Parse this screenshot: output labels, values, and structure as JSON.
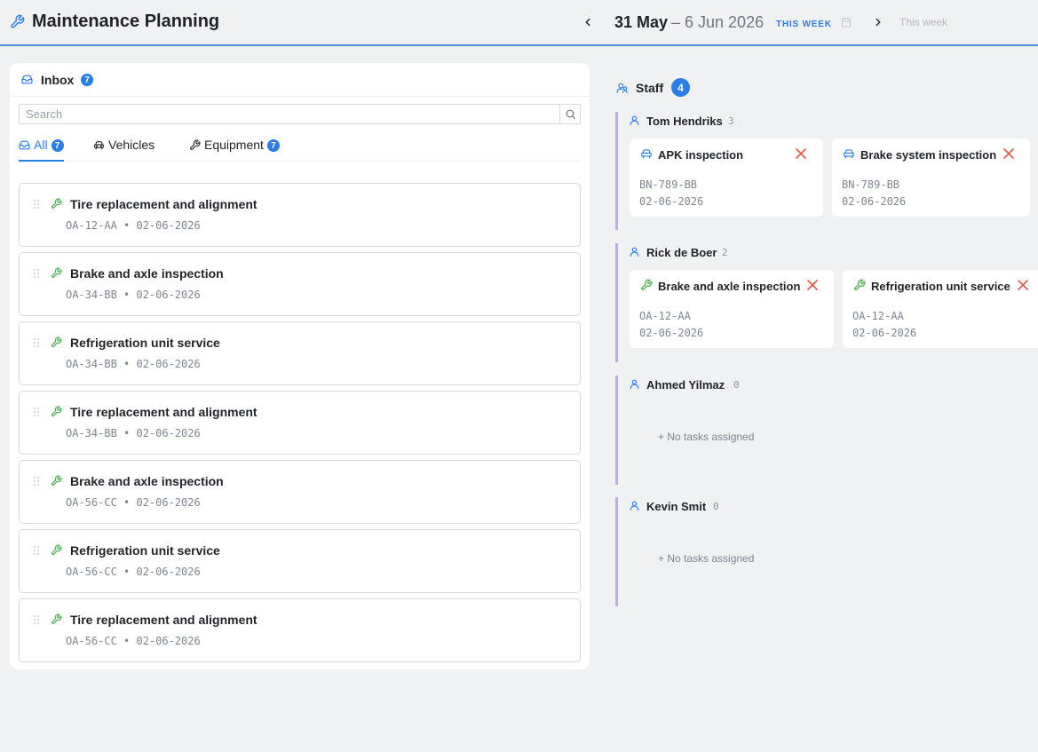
{
  "header": {
    "title": "Maintenance Planning",
    "range_start": "31 May",
    "range_end": "– 6 Jun 2026",
    "this_week_badge": "THIS WEEK",
    "week_label": "This week"
  },
  "inbox": {
    "title": "Inbox",
    "count": "7",
    "search_placeholder": "Search",
    "tabs": [
      {
        "label": "All",
        "count": "7",
        "active": true
      },
      {
        "label": "Vehicles",
        "count": "",
        "active": false
      },
      {
        "label": "Equipment",
        "count": "7",
        "active": false
      }
    ],
    "tasks": [
      {
        "title": "Tire replacement and alignment",
        "meta": "OA-12-AA • 02-06-2026"
      },
      {
        "title": "Brake and axle inspection",
        "meta": "OA-34-BB • 02-06-2026"
      },
      {
        "title": "Refrigeration unit service",
        "meta": "OA-34-BB • 02-06-2026"
      },
      {
        "title": "Tire replacement and alignment",
        "meta": "OA-34-BB • 02-06-2026"
      },
      {
        "title": "Brake and axle inspection",
        "meta": "OA-56-CC • 02-06-2026"
      },
      {
        "title": "Refrigeration unit service",
        "meta": "OA-56-CC • 02-06-2026"
      },
      {
        "title": "Tire replacement and alignment",
        "meta": "OA-56-CC • 02-06-2026"
      }
    ]
  },
  "staff": {
    "title": "Staff",
    "count": "4",
    "empty_label": "+ No tasks assigned",
    "members": [
      {
        "name": "Tom Hendriks",
        "count": "3",
        "tasks": [
          {
            "title": "APK inspection",
            "icon": "car-icon",
            "plate": "BN-789-BB",
            "date": "02-06-2026"
          },
          {
            "title": "Brake system inspection",
            "icon": "car-icon",
            "plate": "BN-789-BB",
            "date": "02-06-2026"
          }
        ]
      },
      {
        "name": "Rick de Boer",
        "count": "2",
        "tasks": [
          {
            "title": "Brake and axle inspection",
            "icon": "wrench-icon",
            "plate": "OA-12-AA",
            "date": "02-06-2026"
          },
          {
            "title": "Refrigeration unit service",
            "icon": "wrench-icon",
            "plate": "OA-12-AA",
            "date": "02-06-2026"
          }
        ]
      },
      {
        "name": "Ahmed Yilmaz",
        "count": "0",
        "tasks": []
      },
      {
        "name": "Kevin Smit",
        "count": "0",
        "tasks": []
      }
    ]
  },
  "colors": {
    "accent": "#2b7de9",
    "equipment_icon": "#4caf50",
    "remove": "#e5534b",
    "staff_rail": "#b6b0e8"
  }
}
